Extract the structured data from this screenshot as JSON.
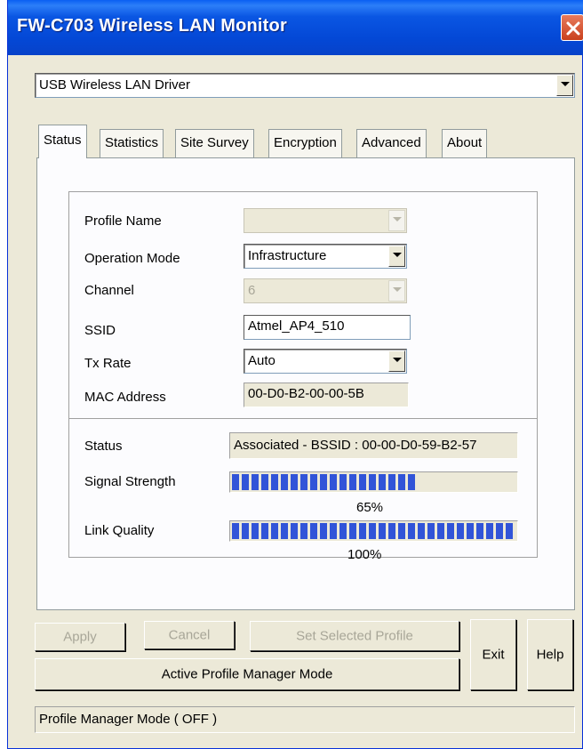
{
  "window": {
    "title": "FW-C703 Wireless LAN Monitor"
  },
  "driver_select": {
    "value": "USB Wireless LAN Driver"
  },
  "tabs": [
    {
      "label": "Status"
    },
    {
      "label": "Statistics"
    },
    {
      "label": "Site Survey"
    },
    {
      "label": "Encryption"
    },
    {
      "label": "Advanced"
    },
    {
      "label": "About"
    }
  ],
  "status_tab": {
    "profile_name_label": "Profile Name",
    "profile_name_value": "",
    "operation_mode_label": "Operation Mode",
    "operation_mode_value": "Infrastructure",
    "channel_label": "Channel",
    "channel_value": "6",
    "ssid_label": "SSID",
    "ssid_value": "Atmel_AP4_510",
    "tx_rate_label": "Tx Rate",
    "tx_rate_value": "Auto",
    "mac_label": "MAC Address",
    "mac_value": "00-D0-B2-00-00-5B",
    "status_label": "Status",
    "status_value": "Associated - BSSID : 00-00-D0-59-B2-57",
    "signal_label": "Signal Strength",
    "signal_percent": 65,
    "signal_text": "65%",
    "link_label": "Link Quality",
    "link_percent": 100,
    "link_text": "100%"
  },
  "buttons": {
    "apply": "Apply",
    "cancel": "Cancel",
    "set_selected_profile": "Set Selected Profile",
    "active_profile_manager": "Active Profile Manager Mode",
    "exit": "Exit",
    "help": "Help"
  },
  "statusbar": {
    "text": "Profile Manager Mode ( OFF )"
  },
  "colors": {
    "titlebar": "#0a56e3",
    "progress": "#3154d8",
    "window_bg": "#ece9d8"
  },
  "icons": {
    "close": "close-icon",
    "dropdown": "chevron-down-icon"
  }
}
